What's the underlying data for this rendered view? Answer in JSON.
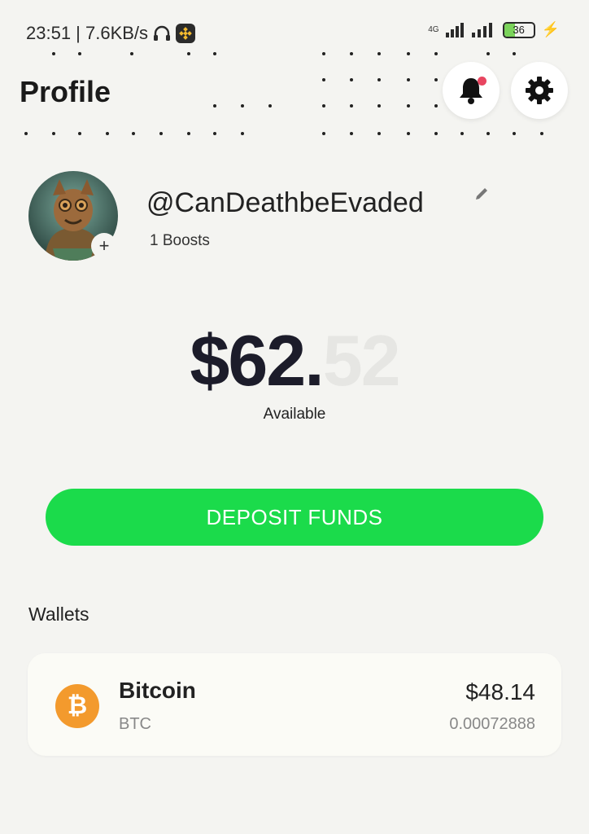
{
  "status_bar": {
    "time_speed": "23:51 | 7.6KB/s",
    "network": "4G",
    "battery": "36",
    "battery_level": 0.36
  },
  "header": {
    "title": "Profile",
    "notification_badge_color": "#e84560"
  },
  "profile": {
    "handle": "@CanDeathbeEvaded",
    "boosts": "1 Boosts",
    "avatar_add": "+"
  },
  "balance": {
    "dollars": "$62.",
    "cents": "52",
    "label": "Available"
  },
  "deposit": {
    "label": "DEPOSIT FUNDS",
    "color": "#1bdb4b"
  },
  "wallets": {
    "title": "Wallets",
    "items": [
      {
        "name": "Bitcoin",
        "ticker": "BTC",
        "usd_value": "$48.14",
        "amount": "0.00072888",
        "symbol": "₿",
        "icon": "bitcoin-icon",
        "color": "#f39a2d"
      }
    ]
  }
}
